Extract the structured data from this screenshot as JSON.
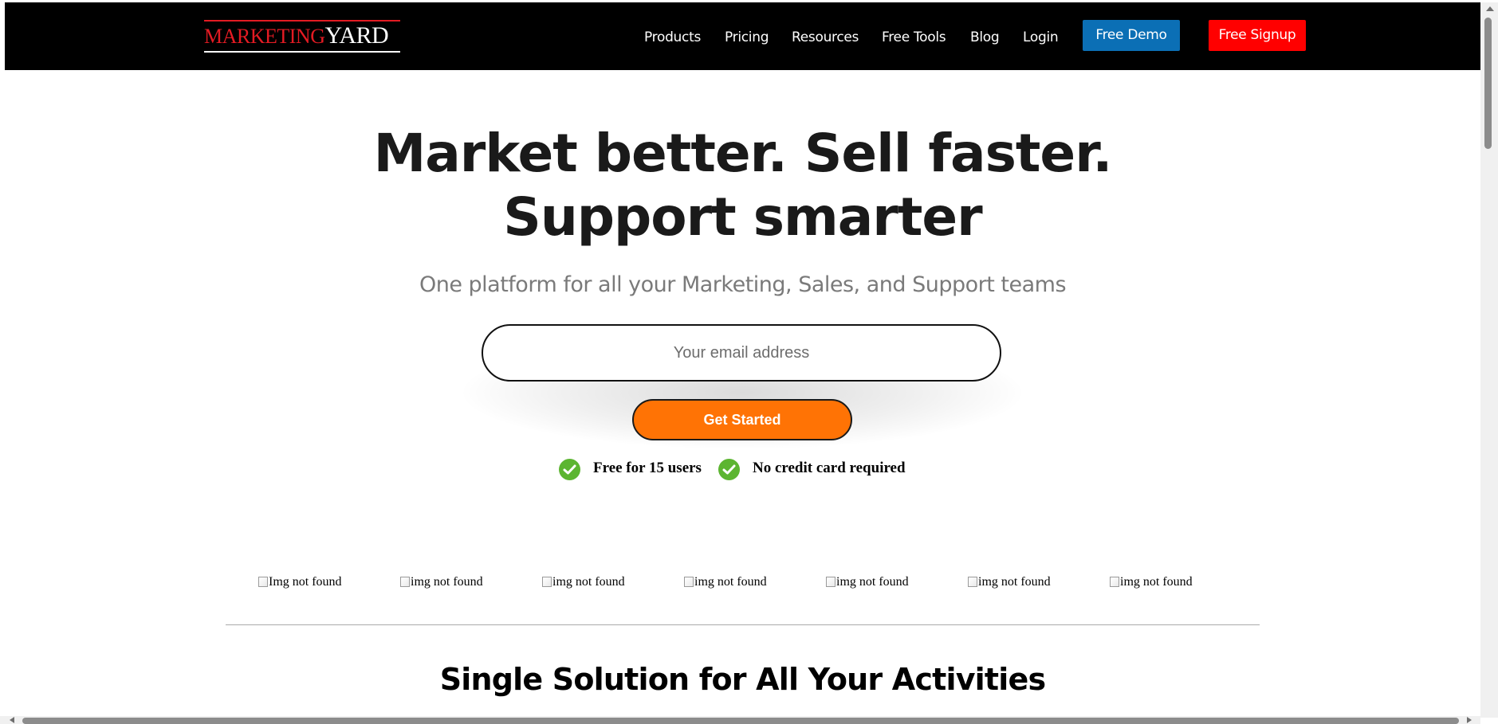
{
  "header": {
    "logo": {
      "part1": "MARKETING",
      "part2": "YARD"
    },
    "nav": [
      "Products",
      "Pricing",
      "Resources",
      "Free Tools",
      "Blog",
      "Login"
    ],
    "demo_label": "Free Demo",
    "signup_label": "Free Signup"
  },
  "hero": {
    "title_line1": "Market better. Sell faster.",
    "title_line2": "Support smarter",
    "subtitle": "One platform for all your Marketing, Sales, and Support teams",
    "email_placeholder": "Your email address",
    "cta_label": "Get Started",
    "perks": [
      "Free for 15 users",
      "No credit card required"
    ]
  },
  "logos": [
    "Img not found",
    "img not found",
    "img not found",
    "img not found",
    "img not found",
    "img not found",
    "img not found"
  ],
  "section": {
    "title": "Single Solution for All Your Activities"
  },
  "colors": {
    "header_bg": "#000000",
    "logo_red": "#e31b23",
    "demo_blue": "#0b6fb5",
    "signup_red": "#ff0000",
    "cta_orange": "#ff7305",
    "check_green": "#5cb531"
  },
  "icons": {
    "perk_check": "check-circle-icon"
  }
}
